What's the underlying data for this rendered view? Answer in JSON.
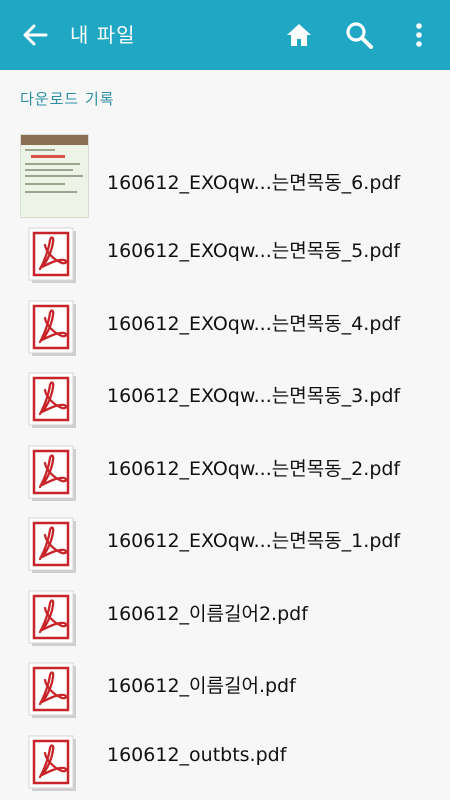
{
  "appbar": {
    "title": "내 파일",
    "back_icon": "arrow-back-icon",
    "home_icon": "home-icon",
    "search_icon": "search-icon",
    "more_icon": "more-vert-icon",
    "background": "#1fa7c4"
  },
  "section": {
    "header": "다운로드 기록"
  },
  "files": [
    {
      "name": "160612_EXOqw...는면목동_6.pdf",
      "thumb": "image"
    },
    {
      "name": "160612_EXOqw...는면목동_5.pdf",
      "thumb": "pdf"
    },
    {
      "name": "160612_EXOqw...는면목동_4.pdf",
      "thumb": "pdf"
    },
    {
      "name": "160612_EXOqw...는면목동_3.pdf",
      "thumb": "pdf"
    },
    {
      "name": "160612_EXOqw...는면목동_2.pdf",
      "thumb": "pdf"
    },
    {
      "name": "160612_EXOqw...는면목동_1.pdf",
      "thumb": "pdf"
    },
    {
      "name": "160612_이름길어2.pdf",
      "thumb": "pdf"
    },
    {
      "name": "160612_이름길어.pdf",
      "thumb": "pdf"
    },
    {
      "name": "160612_outbts.pdf",
      "thumb": "pdf"
    }
  ]
}
